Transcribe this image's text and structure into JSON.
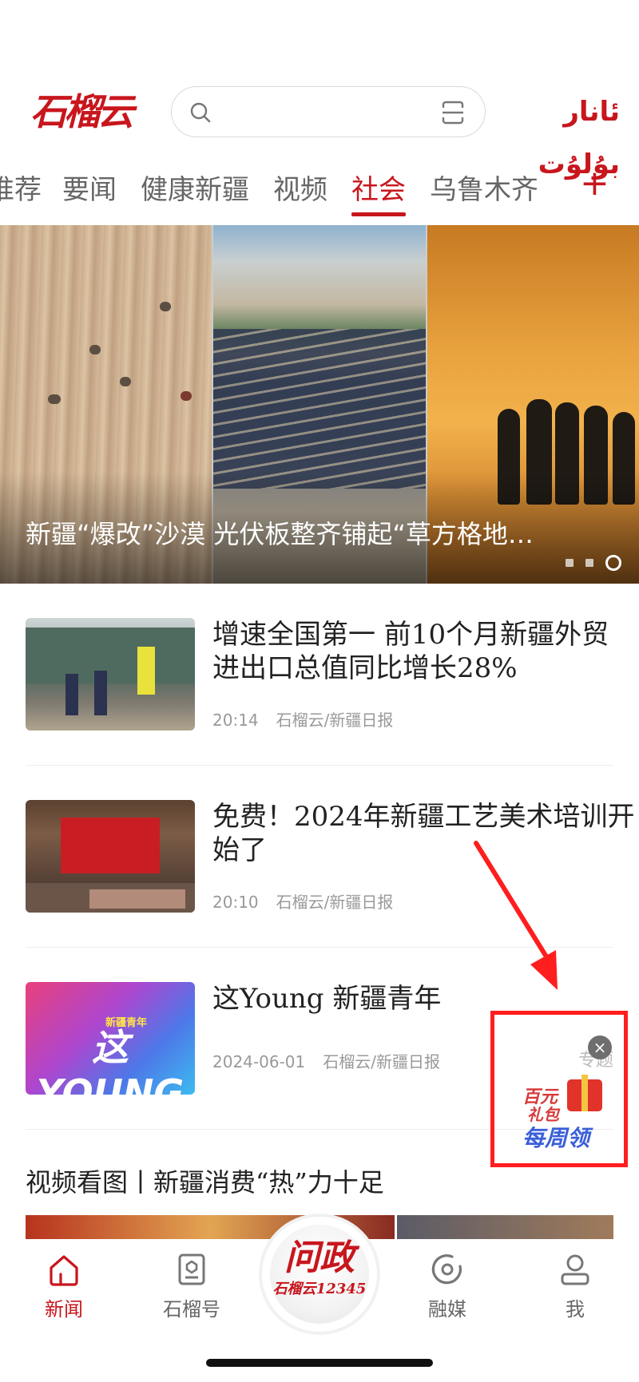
{
  "header": {
    "logo_cn": "石榴云",
    "logo_ug": "ئانار بۇلۇت",
    "search": {
      "placeholder": ""
    }
  },
  "tabs": [
    {
      "label": "推荐",
      "active": false
    },
    {
      "label": "要闻",
      "active": false
    },
    {
      "label": "健康新疆",
      "active": false
    },
    {
      "label": "视频",
      "active": false
    },
    {
      "label": "社会",
      "active": true
    },
    {
      "label": "乌鲁木齐",
      "active": false
    }
  ],
  "tabs_add_label": "+",
  "banner": {
    "title": "新疆“爆改”沙漠 光伏板整齐铺起“草方格地…",
    "page_count": 3,
    "active_page": 3
  },
  "news": [
    {
      "title": "增速全国第一 前10个月新疆外贸进出口总值同比增长28%",
      "time": "20:14",
      "source": "石榴云/新疆日报",
      "thumb_icon": "freight-train-photo"
    },
    {
      "title": "免费！2024年新疆工艺美术培训开始了",
      "time": "20:10",
      "source": "石榴云/新疆日报",
      "thumb_icon": "conference-hall-photo"
    },
    {
      "title": "这Young 新疆青年",
      "time": "2024-06-01",
      "source": "石榴云/新疆日报",
      "thumb_text": "这YOUNG",
      "thumb_subtext": "新疆青年",
      "tag": "专题"
    }
  ],
  "section": {
    "title": "视频看图丨新疆消费“热”力十足"
  },
  "float_widget": {
    "line1": "百元",
    "line2": "礼包",
    "line3": "每周领",
    "close_label": "×"
  },
  "bottom_nav": {
    "items": [
      {
        "label": "新闻",
        "icon": "home-icon",
        "active": true
      },
      {
        "label": "石榴号",
        "icon": "badge-icon",
        "active": false
      },
      {
        "label": "融媒",
        "icon": "media-disc-icon",
        "active": false
      },
      {
        "label": "我",
        "icon": "user-icon",
        "active": false
      }
    ],
    "center": {
      "line1": "问政",
      "line2": "石榴云12345"
    }
  },
  "colors": {
    "brand": "#c8161d",
    "annotation": "#ff1e1e",
    "meta_text": "#999999"
  }
}
